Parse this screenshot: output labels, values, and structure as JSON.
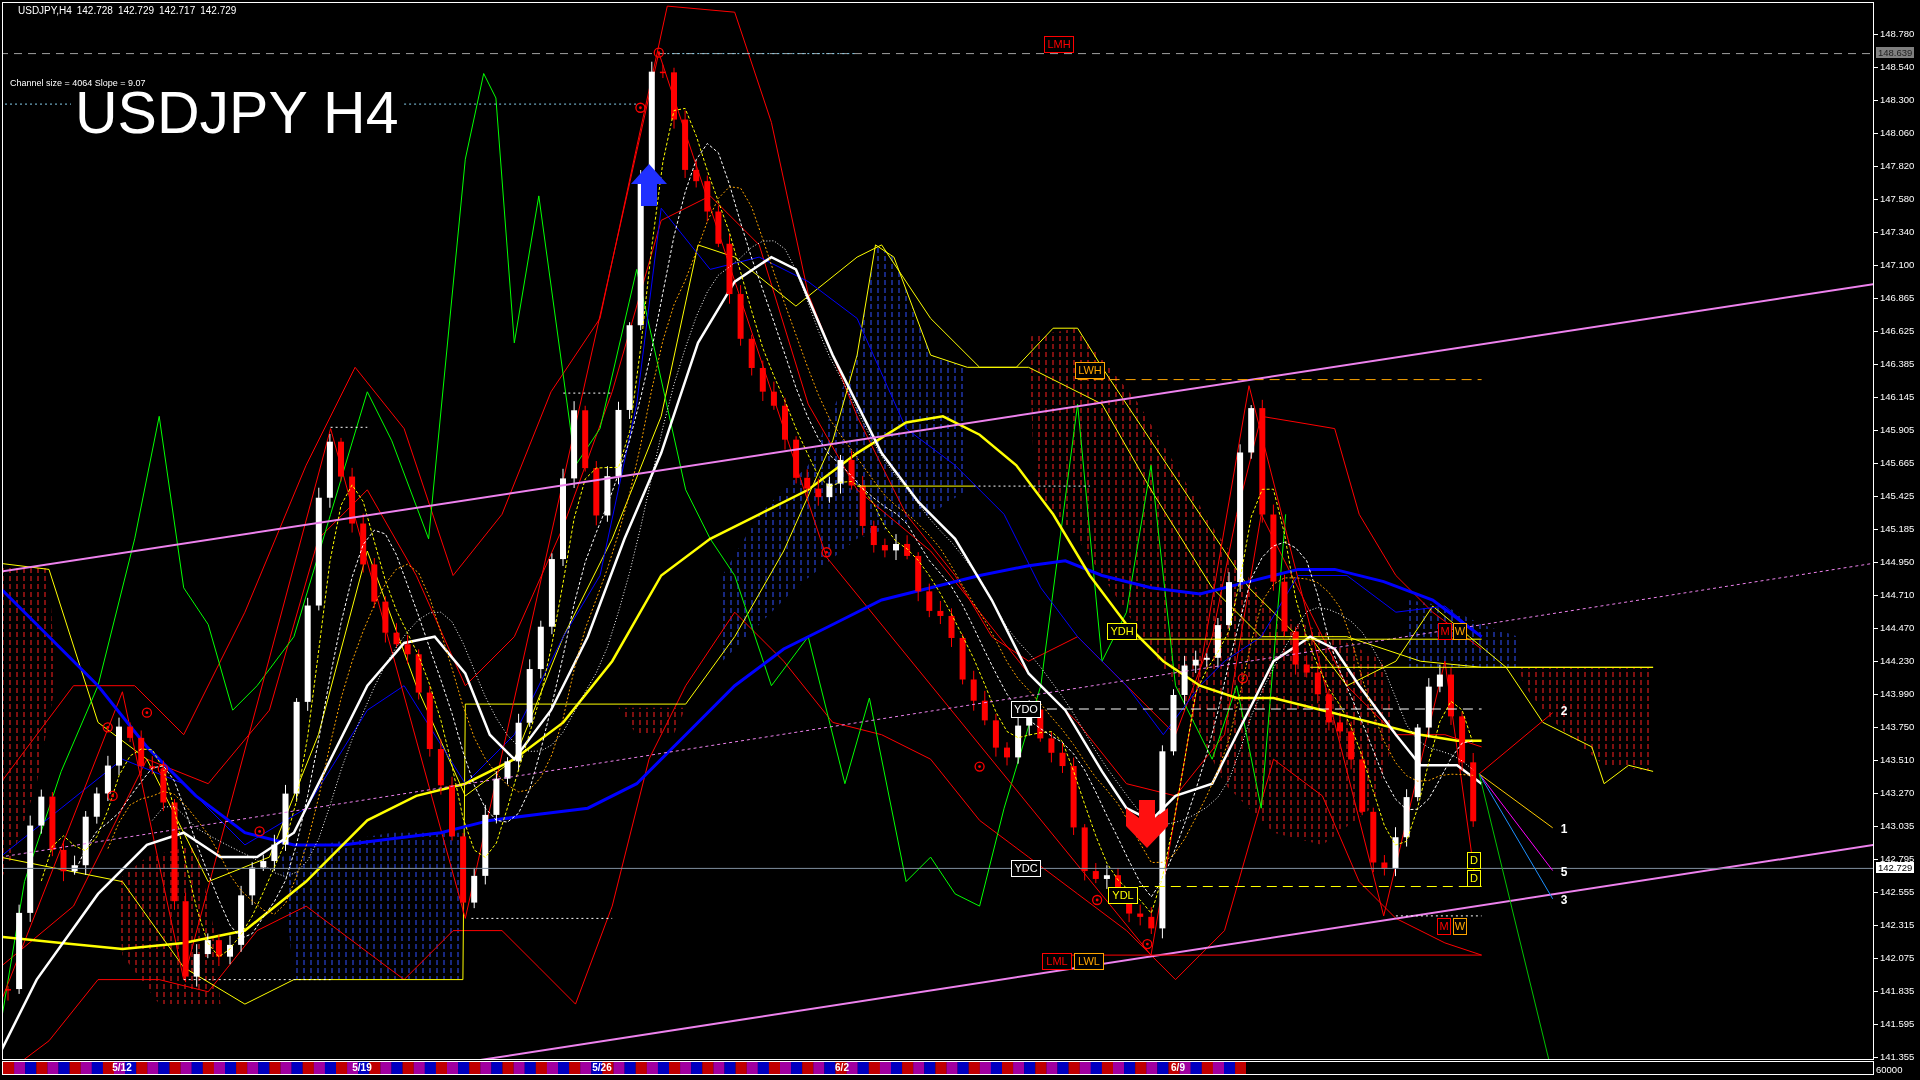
{
  "chart": {
    "symbol": "USDJPY,H4",
    "ohlc": [
      "142.728",
      "142.729",
      "142.717",
      "142.729"
    ],
    "channel_info": "Channel size = 4064 Slope = 9.07",
    "title": "USDJPY H4",
    "level_labels": [
      {
        "text": "LMH",
        "color": "#ff0000"
      },
      {
        "text": "LWH",
        "color": "#ffa500"
      },
      {
        "text": "YDH",
        "color": "#ffff00"
      },
      {
        "text": "YDO",
        "color": "#ffffff"
      },
      {
        "text": "YDC",
        "color": "#ffffff"
      },
      {
        "text": "YDL",
        "color": "#ffff00"
      },
      {
        "text": "LML",
        "color": "#ff0000"
      },
      {
        "text": "LWL",
        "color": "#ffa500"
      },
      {
        "text": "M",
        "color": "#ff0000"
      },
      {
        "text": "W",
        "color": "#ffa500"
      },
      {
        "text": "D",
        "color": "#ffff00"
      },
      {
        "text": "D",
        "color": "#ffff00"
      },
      {
        "text": "M",
        "color": "#ff0000"
      },
      {
        "text": "W",
        "color": "#ffa500"
      }
    ],
    "projection_labels": [
      "2",
      "1",
      "5",
      "3"
    ]
  },
  "price_axis": {
    "ticks": [
      "148.780",
      "148.540",
      "148.300",
      "148.060",
      "147.820",
      "147.580",
      "147.340",
      "147.100",
      "146.865",
      "146.625",
      "146.385",
      "146.145",
      "145.905",
      "145.665",
      "145.425",
      "145.185",
      "144.950",
      "144.710",
      "144.470",
      "144.230",
      "143.990",
      "143.750",
      "143.510",
      "143.270",
      "143.035",
      "142.795",
      "142.555",
      "142.315",
      "142.075",
      "141.835",
      "141.595",
      "141.355"
    ],
    "markers": [
      {
        "kind": "high",
        "text": "148.639"
      },
      {
        "kind": "bid",
        "text": "142.729"
      }
    ]
  },
  "time_axis": {
    "labels": [
      "5/12",
      "5/19",
      "5/26",
      "6/2",
      "6/9"
    ]
  },
  "volume_scale": "60000"
}
